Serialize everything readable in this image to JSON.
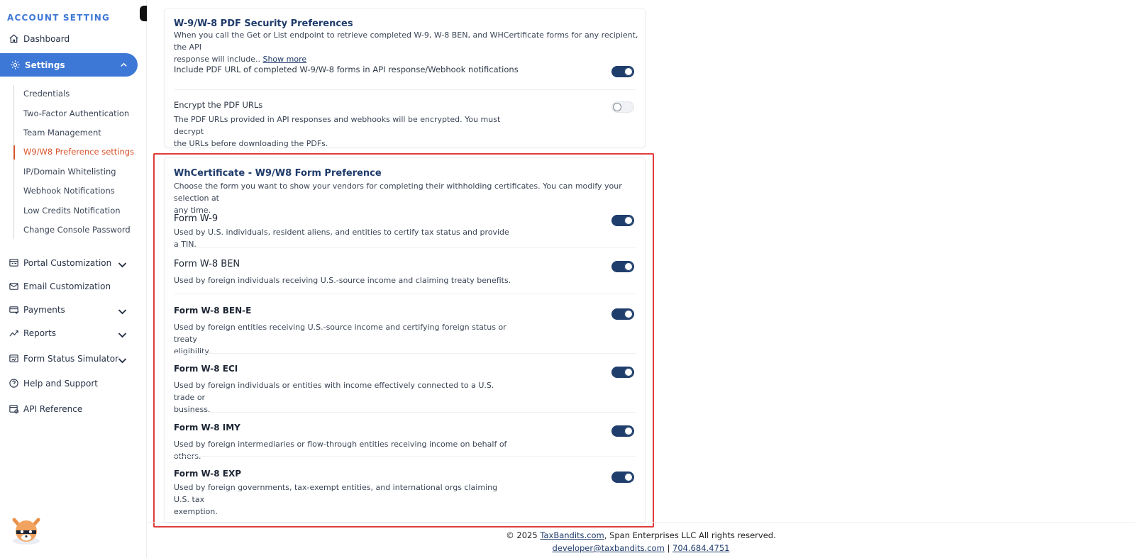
{
  "sidebar": {
    "heading": "ACCOUNT SETTING",
    "dashboard": "Dashboard",
    "settings": "Settings",
    "sub_items": [
      "Credentials",
      "Two-Factor Authentication",
      "Team Management",
      "W9/W8 Preference settings",
      "IP/Domain Whitelisting",
      "Webhook Notifications",
      "Low Credits Notification",
      "Change Console Password"
    ],
    "active_sub_index": 3,
    "items": [
      {
        "label": "Portal Customization",
        "expandable": true
      },
      {
        "label": "Email Customization",
        "expandable": false
      },
      {
        "label": "Payments",
        "expandable": true
      },
      {
        "label": "Reports",
        "expandable": true
      },
      {
        "label": "Form Status Simulator",
        "expandable": true
      },
      {
        "label": "Help and Support",
        "expandable": false
      },
      {
        "label": "API Reference",
        "expandable": false
      }
    ]
  },
  "security_card": {
    "title": "W-9/W-8 PDF Security Preferences",
    "desc_line1": "When you call the Get or List endpoint to retrieve completed W-9, W-8 BEN, and WHCertificate forms for any recipient, the API",
    "desc_line2": "response will include..",
    "show_more": "Show more",
    "include_pdf_label": "Include PDF URL of completed W-9/W-8 forms in API response/Webhook notifications",
    "include_pdf_on": true,
    "encrypt_title": "Encrypt the PDF URLs",
    "encrypt_desc_line1": "The PDF URLs provided in API responses and webhooks will be encrypted. You must decrypt",
    "encrypt_desc_line2": "the URLs before downloading the PDFs.",
    "encrypt_on": false
  },
  "form_card": {
    "title": "WhCertificate - W9/W8 Form Preference",
    "desc_line1": "Choose the form you want to show your vendors for completing their withholding certificates. You can modify your selection at",
    "desc_line2": "any time.",
    "forms": [
      {
        "title": "Form W-9",
        "desc1": "Used by U.S. individuals, resident aliens, and entities to certify tax status and provide a TIN.",
        "desc2": "",
        "on": true
      },
      {
        "title": "Form W-8 BEN",
        "desc1": "Used by foreign individuals receiving U.S.-source income and claiming treaty benefits.",
        "desc2": "",
        "on": true
      },
      {
        "title": "Form W-8 BEN-E",
        "desc1": "Used by foreign entities receiving U.S.-source income and certifying foreign status or treaty",
        "desc2": "eligibility.",
        "on": true
      },
      {
        "title": "Form W-8 ECI",
        "desc1": "Used by foreign individuals or entities with income effectively connected to a U.S. trade or",
        "desc2": "business.",
        "on": true
      },
      {
        "title": "Form W-8 IMY",
        "desc1": "Used by foreign intermediaries or flow-through entities receiving income on behalf of others.",
        "desc2": "",
        "on": true
      },
      {
        "title": "Form W-8 EXP",
        "desc1": "Used by foreign governments, tax-exempt entities, and international orgs claiming U.S. tax",
        "desc2": "exemption.",
        "on": true
      }
    ]
  },
  "footer": {
    "copyright_prefix": "© 2025 ",
    "site_link": "TaxBandits.com",
    "copyright_suffix": ", Span Enterprises LLC All rights reserved.",
    "email": "developer@taxbandits.com",
    "separator": " | ",
    "phone": "704.684.4751"
  }
}
